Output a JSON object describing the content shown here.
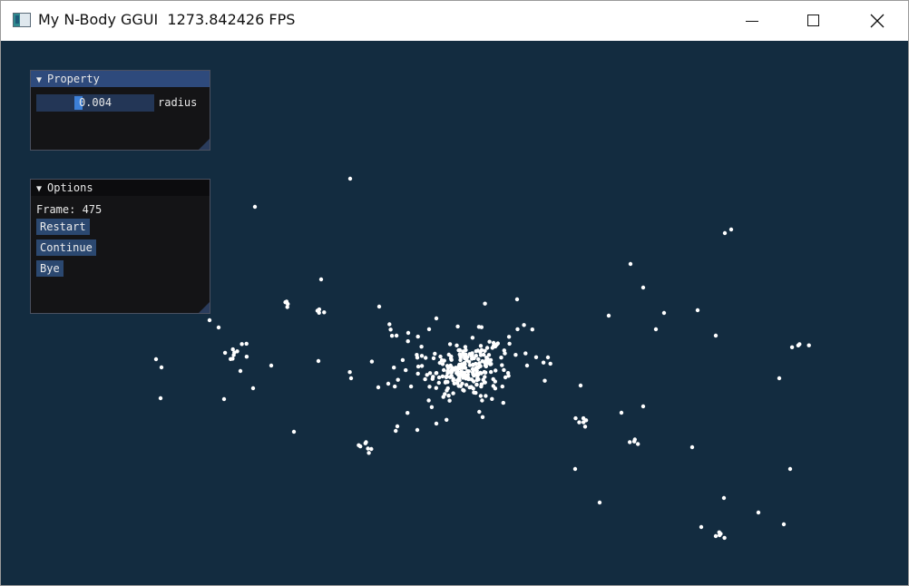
{
  "window": {
    "title": "My N-Body GGUI  1273.842426 FPS",
    "icon": "app-window-icon",
    "controls": [
      "minimize-icon",
      "maximize-icon",
      "close-icon"
    ]
  },
  "scene": {
    "background_color": "#132c40",
    "particle_color": "#ffffff"
  },
  "property_panel": {
    "title": "Property",
    "collapse_icon": "triangle-down-icon",
    "radius_slider": {
      "value": "0.004",
      "label": "radius"
    }
  },
  "options_panel": {
    "title": "Options",
    "collapse_icon": "triangle-down-icon",
    "frame_text": "Frame: 475",
    "buttons": {
      "restart": "Restart",
      "continue": "Continue",
      "bye": "Bye"
    }
  },
  "colors": {
    "panel_bg": "#141416",
    "active_title": "#2e4a7c",
    "inactive_title": "#0c0c0e",
    "button": "#2b4870",
    "slider_frame": "#233656",
    "slider_grab": "#3d80d8"
  }
}
